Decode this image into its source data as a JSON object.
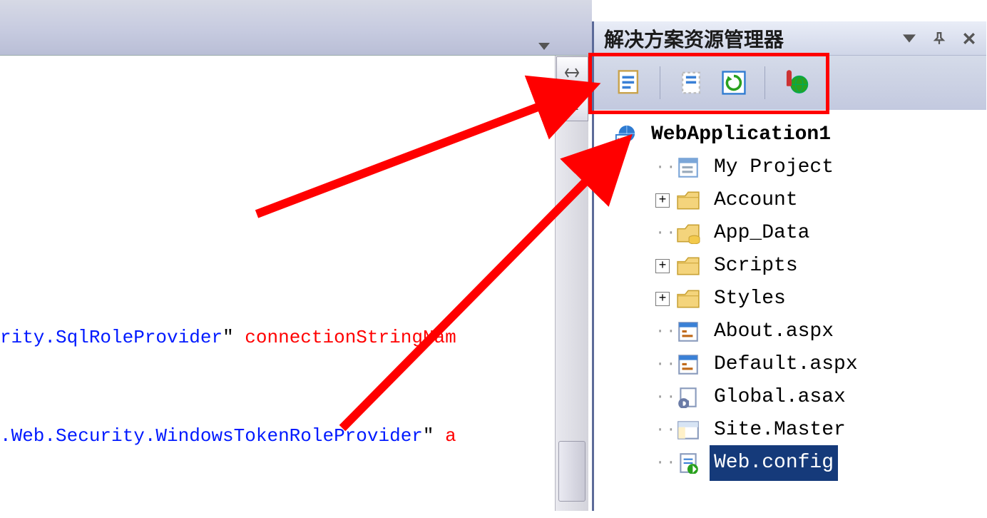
{
  "topbar": {},
  "code": {
    "line1": {
      "part1": "rity.SqlRoleProvider",
      "quote1": "\"",
      "space1": " ",
      "attr": "connectionStringNam"
    },
    "line2": {
      "part1": ".Web.Security.WindowsTokenRoleProvider",
      "quote1": "\"",
      "space1": " ",
      "attr_frag": "a"
    }
  },
  "solution": {
    "title": "解决方案资源管理器",
    "root": "WebApplication1",
    "items": [
      {
        "label": "My Project",
        "icon": "props-icon",
        "expandable": false
      },
      {
        "label": "Account",
        "icon": "folder-icon",
        "expandable": true
      },
      {
        "label": "App_Data",
        "icon": "appdata-icon",
        "expandable": false
      },
      {
        "label": "Scripts",
        "icon": "folder-icon",
        "expandable": true
      },
      {
        "label": "Styles",
        "icon": "folder-icon",
        "expandable": true
      },
      {
        "label": "About.aspx",
        "icon": "aspx-icon",
        "expandable": false
      },
      {
        "label": "Default.aspx",
        "icon": "aspx-icon",
        "expandable": false
      },
      {
        "label": "Global.asax",
        "icon": "asax-icon",
        "expandable": false
      },
      {
        "label": "Site.Master",
        "icon": "master-icon",
        "expandable": false
      },
      {
        "label": "Web.config",
        "icon": "config-icon",
        "expandable": false,
        "selected": true
      }
    ]
  }
}
